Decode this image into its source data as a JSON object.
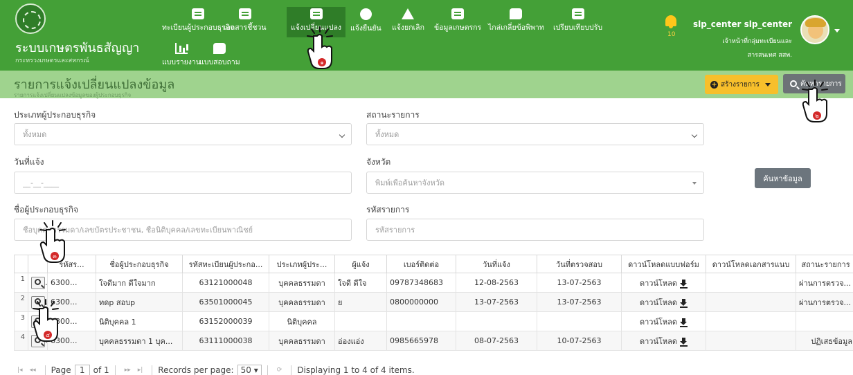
{
  "header": {
    "system_title": "ระบบเกษตรพันธสัญญา",
    "ministry": "กระทรวงเกษตรและสหกรณ์",
    "nav": [
      {
        "label": "ทะเบียนผู้ประกอบธุรกิจ",
        "icon": "id-card-icon"
      },
      {
        "label": "เอกสารชี้ชวน",
        "icon": "clipboard-icon"
      },
      {
        "label": "แจ้งเปลี่ยนแปลง",
        "icon": "edit-icon"
      },
      {
        "label": "แจ้งยืนยัน",
        "icon": "check-circle-icon"
      },
      {
        "label": "แจ้งยกเลิก",
        "icon": "warning-icon"
      },
      {
        "label": "ข้อมูลเกษตรกร",
        "icon": "farmer-card-icon"
      },
      {
        "label": "ไกล่เกลี่ยข้อพิพาท",
        "icon": "chat-icon"
      },
      {
        "label": "เปรียบเทียบปรับ",
        "icon": "invoice-icon"
      },
      {
        "label": "แบบรายงาน",
        "icon": "bar-chart-icon"
      },
      {
        "label": "แบบสอบถาม",
        "icon": "comments-icon"
      }
    ],
    "notification_count": "10",
    "user_name": "slp_center slp_center",
    "user_role": "เจ้าหน้าที่กลุ่มทะเบียนและ",
    "user_org": "สารสนเทศ สสพ."
  },
  "page": {
    "title": "รายการแจ้งเปลี่ยนแปลงข้อมูล",
    "subtitle": "รายการแจ้งเปลี่ยนแปลงข้อมูลของผู้ประกอบธุรกิจ",
    "create_label": "สร้างรายการ",
    "search_top_label": "ค้นหารายการ"
  },
  "form": {
    "business_type_label": "ประเภทผู้ประกอบธุรกิจ",
    "business_type_value": "ทั้งหมด",
    "status_label": "สถานะรายการ",
    "status_value": "ทั้งหมด",
    "date_label": "วันที่แจ้ง",
    "date_placeholder": "__-__-____",
    "province_label": "จังหวัด",
    "province_placeholder": "พิมพ์เพื่อค้นหาจังหวัด",
    "name_label": "ชื่อผู้ประกอบธุรกิจ",
    "name_placeholder": "ชื่อบุคคลธรรมดา/เลขบัตรประชาชน, ชื่อนิติบุคคล/เลขทะเบียนพาณิชย์",
    "code_label": "รหัสรายการ",
    "code_placeholder": "รหัสรายการ",
    "find_label": "ค้นหาข้อมูล"
  },
  "table": {
    "columns": [
      "",
      "",
      "รหัสร...",
      "ชื่อผู้ประกอบธุรกิจ",
      "รหัสทะเบียนผู้ประกอ...",
      "ประเภทผู้ประ...",
      "ผู้แจ้ง",
      "เบอร์ติดต่อ",
      "วันที่แจ้ง",
      "วันที่ตรวจสอบ",
      "ดาวน์โหลดแบบฟอร์ม",
      "ดาวน์โหลดเอกสารแนบ",
      "สถานะรายการ"
    ],
    "download_label": "ดาวน์โหลด",
    "rows": [
      {
        "no": "1",
        "code": "6300...",
        "name": "ใจดีมาก ดีใจมาก",
        "reg": "63121000048",
        "type": "บุคคลธรรมดา",
        "reporter": "ใจดี ดีใจ",
        "phone": "09787348683",
        "date": "12-08-2563",
        "checked": "13-07-2563",
        "attach": "",
        "status": "ผ่านการตรวจ..."
      },
      {
        "no": "2",
        "code": "6300...",
        "name": "ทดp สอบp",
        "reg": "63501000045",
        "type": "บุคคลธรรมดา",
        "reporter": "ย",
        "phone": "0800000000",
        "date": "13-07-2563",
        "checked": "13-07-2563",
        "attach": "",
        "status": "ผ่านการตรวจ..."
      },
      {
        "no": "3",
        "code": "6300...",
        "name": "นิติบุคคล 1",
        "reg": "63152000039",
        "type": "นิติบุคคล",
        "reporter": "",
        "phone": "",
        "date": "",
        "checked": "",
        "attach": "",
        "status": ""
      },
      {
        "no": "4",
        "code": "6300...",
        "name": "บุคคลธรรมดา 1 บุค...",
        "reg": "63111000038",
        "type": "บุคคลธรรมดา",
        "reporter": "อ่องแอ่ง",
        "phone": "0985665978",
        "date": "08-07-2563",
        "checked": "10-07-2563",
        "attach": "",
        "status": "ปฏิเสธข้อมูล"
      }
    ]
  },
  "pager": {
    "page_label": "Page",
    "page_value": "1",
    "of_label": "of 1",
    "records_label": "Records per page:",
    "records_value": "50",
    "display_text": "Displaying 1 to 4 of 4 items."
  },
  "pointers": [
    {
      "step": "๑",
      "target": "nav-change"
    },
    {
      "step": "๒",
      "target": "search-top"
    },
    {
      "step": "๓",
      "target": "name-field"
    },
    {
      "step": "๔",
      "target": "row-3-view"
    }
  ],
  "colors": {
    "header_green": "#44a037",
    "active_nav": "#2f7d28",
    "title_band": "#9fd38e",
    "create_button": "#f7bf2b",
    "secondary_button": "#6c757d",
    "pointer_red": "#d42a2a"
  }
}
